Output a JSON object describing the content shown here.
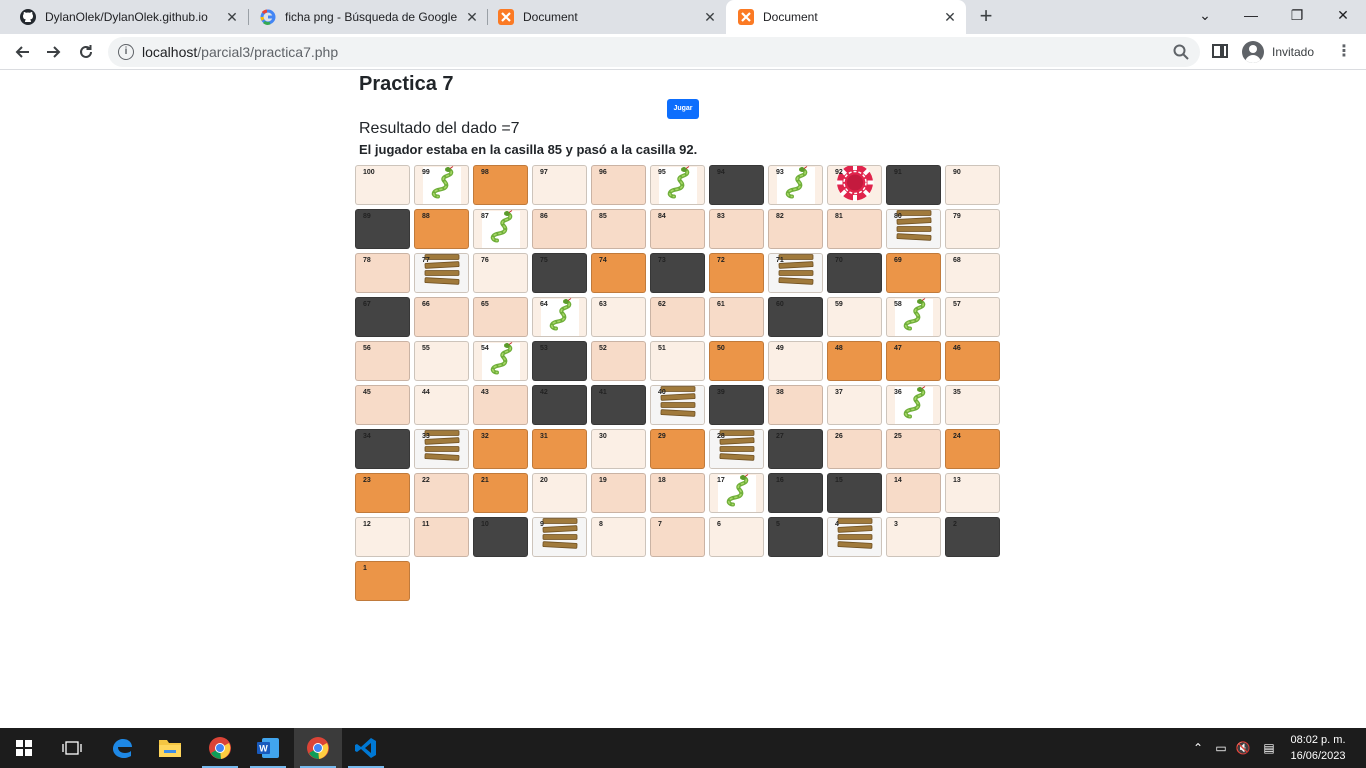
{
  "browser": {
    "tabs": [
      {
        "title": "DylanOlek/DylanOlek.github.io",
        "icon": "github-icon",
        "active": false
      },
      {
        "title": "ficha png - Búsqueda de Google",
        "icon": "google-icon",
        "active": false
      },
      {
        "title": "Document",
        "icon": "xampp-icon",
        "active": false
      },
      {
        "title": "Document",
        "icon": "xampp-icon",
        "active": true
      }
    ],
    "url_host": "localhost",
    "url_path": "/parcial3/practica7.php",
    "profile_name": "Invitado"
  },
  "page": {
    "title": "Practica 7",
    "button_label": "Jugar",
    "resultado": "Resultado del dado =7",
    "mensaje": "El jugador estaba en la casilla 85 y pasó a la casilla 92.",
    "board": {
      "rows": [
        [
          100,
          99,
          98,
          97,
          96,
          95,
          94,
          93,
          92,
          91,
          90
        ],
        [
          89,
          88,
          87,
          86,
          85,
          84,
          83,
          82,
          81,
          80,
          79
        ],
        [
          78,
          77,
          76,
          75,
          74,
          73,
          72,
          71,
          70,
          69,
          68
        ],
        [
          67,
          66,
          65,
          64,
          63,
          62,
          61,
          60,
          59,
          58,
          57
        ],
        [
          56,
          55,
          54,
          53,
          52,
          51,
          50,
          49,
          48,
          47,
          46
        ],
        [
          45,
          44,
          43,
          42,
          41,
          40,
          39,
          38,
          37,
          36,
          35
        ],
        [
          34,
          33,
          32,
          31,
          30,
          29,
          28,
          27,
          26,
          25,
          24
        ],
        [
          23,
          22,
          21,
          20,
          19,
          18,
          17,
          16,
          15,
          14,
          13
        ],
        [
          12,
          11,
          10,
          9,
          8,
          7,
          6,
          5,
          4,
          3,
          2
        ],
        [
          1
        ]
      ],
      "cell_colors": {
        "light": "#fbefe5",
        "peach": "#f7dbc8",
        "orange": "#eb9548",
        "dark": "#444444"
      },
      "dark_cells": [
        94,
        91,
        89,
        75,
        73,
        70,
        67,
        60,
        53,
        42,
        41,
        39,
        34,
        27,
        16,
        15,
        10,
        5,
        2
      ],
      "orange_cells": [
        98,
        88,
        74,
        72,
        69,
        50,
        48,
        47,
        46,
        32,
        31,
        29,
        24,
        23,
        21,
        1
      ],
      "peach_cells": [
        96,
        86,
        85,
        84,
        83,
        82,
        81,
        78,
        62,
        61,
        66,
        65,
        56,
        52,
        45,
        43,
        38,
        26,
        25,
        22,
        19,
        18,
        14,
        11,
        7
      ],
      "snake_cells": [
        99,
        95,
        93,
        87,
        64,
        58,
        54,
        36,
        17
      ],
      "ladder_cells": [
        80,
        77,
        71,
        40,
        33,
        28,
        9,
        4
      ],
      "player_cell": 92
    }
  },
  "taskbar": {
    "apps": [
      "windows-start-icon",
      "task-view-icon",
      "edge-icon",
      "file-explorer-icon",
      "chrome-icon",
      "word-icon",
      "chrome-icon",
      "vscode-icon"
    ],
    "time": "08:02 p. m.",
    "date": "16/06/2023"
  }
}
